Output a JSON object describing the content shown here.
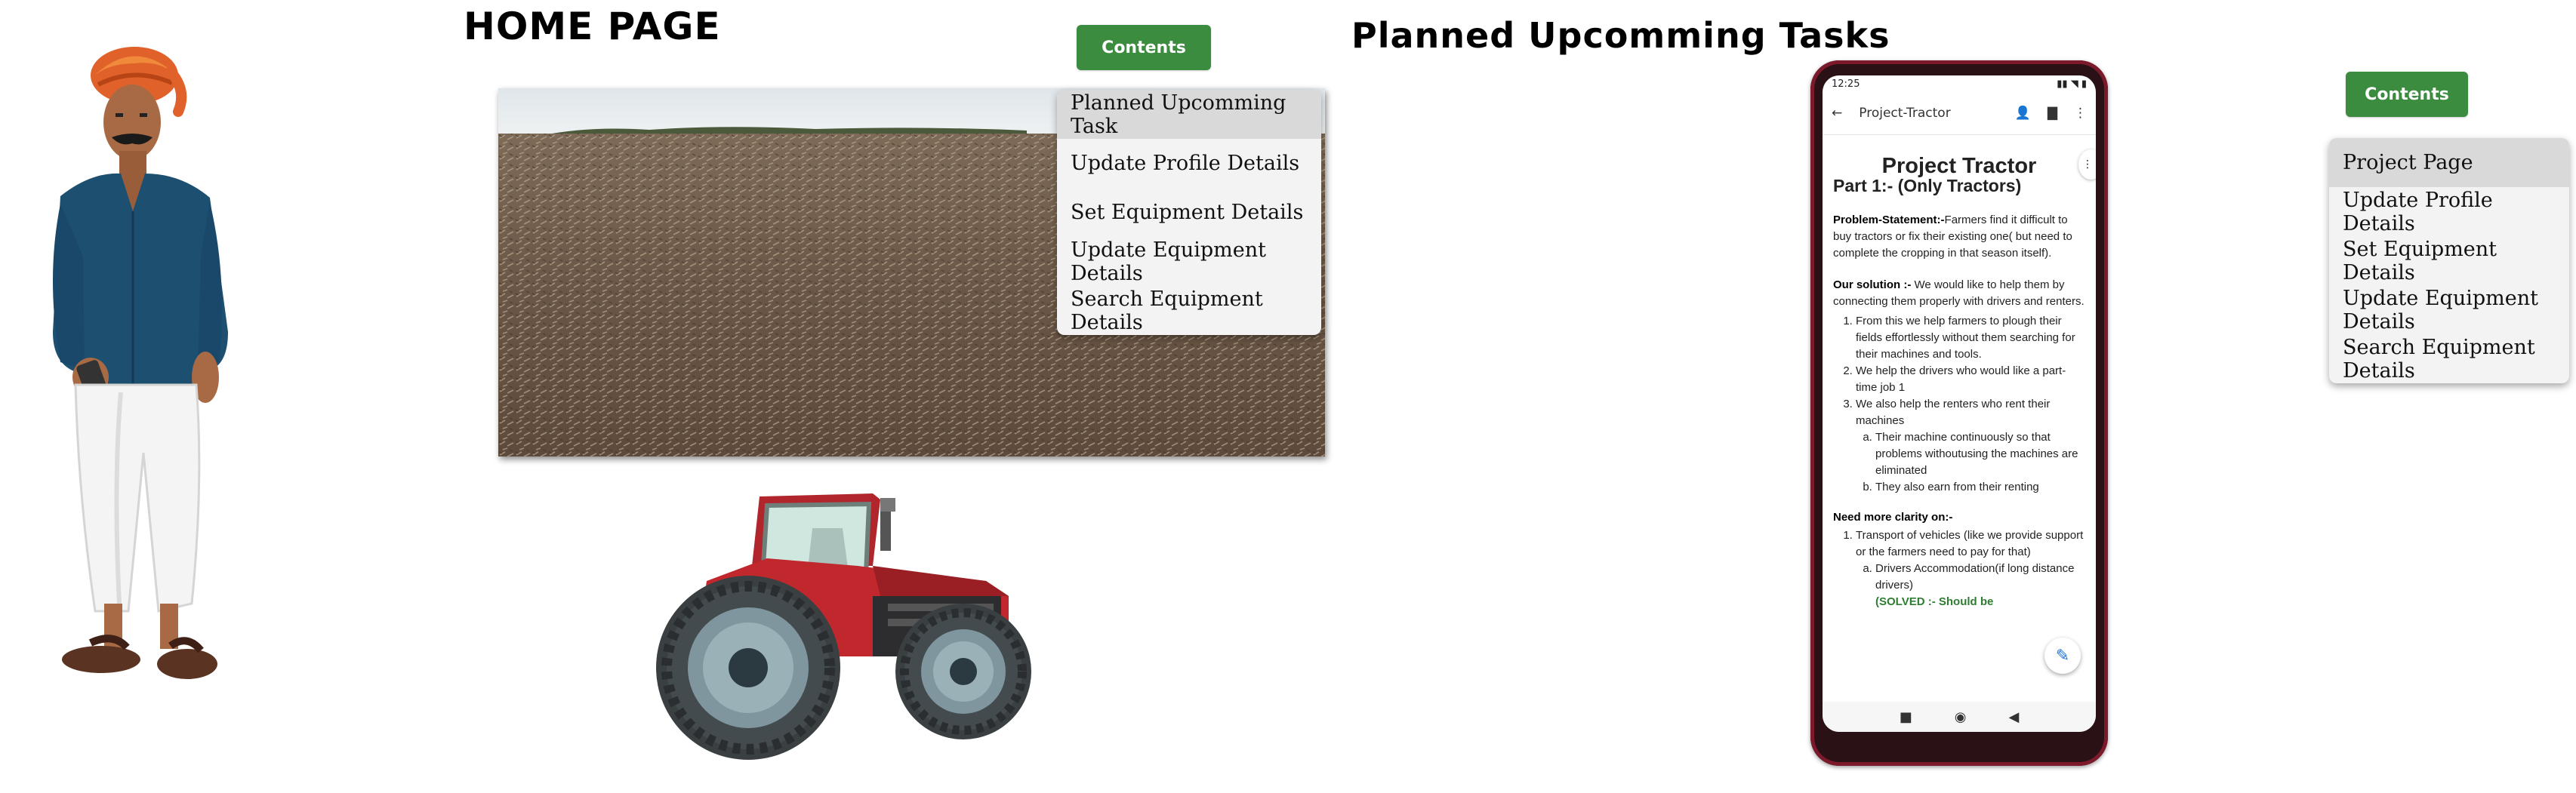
{
  "home": {
    "title": "HOME PAGE",
    "contents_button": "Contents",
    "menu": [
      "Planned Upcomming Task",
      "Update Profile Details",
      "Set Equipment Details",
      "Update Equipment Details",
      "Search Equipment Details"
    ]
  },
  "tasks": {
    "title": "Planned Upcomming Tasks",
    "contents_button": "Contents",
    "menu": [
      "Project Page",
      "Update Profile Details",
      "Set Equipment Details",
      "Update Equipment Details",
      "Search Equipment Details"
    ]
  },
  "phone": {
    "status_time": "12:25",
    "appbar_title": "Project-Tractor",
    "doc": {
      "title": "Project Tractor",
      "subtitle": "Part 1:- (Only Tractors)",
      "problem_label": "Problem-Statement:-",
      "problem_text": "Farmers find it difficult to buy tractors or fix their existing one( but need to complete the cropping in that season itself).",
      "solution_label": "Our solution :-",
      "solution_text": "We would like to help them by connecting them properly with drivers and renters.",
      "solution_points": [
        "From this we help farmers to plough their fields effortlessly without them searching for their machines and tools.",
        "We help the drivers who would like a part-time job 1",
        "We also help the renters who rent their machines"
      ],
      "renter_subpoints": [
        "Their machine continuously so that problems withoutusing the machines are eliminated",
        "They also earn from their renting"
      ],
      "clarity_label": "Need more clarity on:-",
      "clarity_points": [
        "Transport of vehicles (like we provide support or the farmers need to pay for that)"
      ],
      "clarity_subpoints": [
        "Drivers Accommodation(if long distance drivers)"
      ],
      "solved_text": "(SOLVED :- Should be"
    }
  },
  "colors": {
    "button_green": "#3c8c3f",
    "phone_frame": "#7c1a2c"
  }
}
